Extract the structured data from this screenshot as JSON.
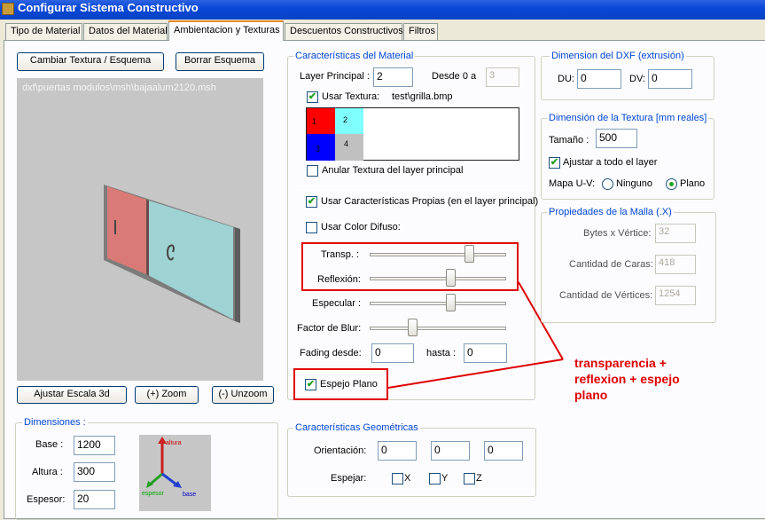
{
  "window": {
    "title": "Configurar Sistema Constructivo"
  },
  "tabs": [
    {
      "label": "Tipo de Material"
    },
    {
      "label": "Datos del Material"
    },
    {
      "label": "Ambientacion y Texturas"
    },
    {
      "label": "Descuentos Constructivos"
    },
    {
      "label": "Filtros"
    }
  ],
  "left": {
    "change_texture_label": "Cambiar Textura / Esquema",
    "erase_scheme_label": "Borrar Esquema",
    "preview_path": "dxf\\puertas modulos\\msh\\bajaalum2120.msh",
    "fit_scale_label": "Ajustar Escala 3d",
    "zoom_label": "(+) Zoom",
    "unzoom_label": "(-) Unzoom"
  },
  "dimensiones": {
    "title": "Dimensiones :",
    "base_label": "Base :",
    "base_value": "1200",
    "altura_label": "Altura :",
    "altura_value": "300",
    "espesor_label": "Espesor:",
    "espesor_value": "20",
    "axis_altura": "altura",
    "axis_espesor": "espesor",
    "axis_base": "base"
  },
  "material": {
    "title": "Características del Material",
    "layer_label": "Layer Principal :",
    "layer_value": "2",
    "desde_label": "Desde 0 a",
    "desde_value": "3",
    "usar_textura_label": "Usar Textura:",
    "usar_textura_checked": true,
    "texture_file": "test\\grilla.bmp",
    "cells": [
      "1",
      "2",
      "3",
      "4"
    ],
    "anular_label": "Anular Textura del layer principal",
    "anular_checked": false,
    "propias_label": "Usar Características Propias (en el layer principal)",
    "propias_checked": true,
    "difuso_label": "Usar Color Difuso:",
    "difuso_checked": false,
    "transp_label": "Transp. :",
    "transp_level": 0.75,
    "reflexion_label": "Reflexión:",
    "reflexion_level": 0.6,
    "especular_label": "Especular :",
    "especular_level": 0.6,
    "blur_label": "Factor de Blur:",
    "blur_level": 0.3,
    "fading_label": "Fading desde:",
    "fading_value": "0",
    "hasta_label": "hasta :",
    "hasta_value": "0",
    "espejo_label": "Espejo Plano",
    "espejo_checked": true
  },
  "dxf": {
    "title": "Dimension del DXF (extrusión)",
    "du_label": "DU:",
    "du_value": "0",
    "dv_label": "DV:",
    "dv_value": "0"
  },
  "textura_dim": {
    "title": "Dimensión de la Textura [mm reales]",
    "tamano_label": "Tamaño :",
    "tamano_value": "500",
    "ajustar_label": "Ajustar a todo el layer",
    "ajustar_checked": true,
    "mapa_label": "Mapa U-V:",
    "ninguno_label": "Ninguno",
    "plano_label": "Plano",
    "selected": "Plano"
  },
  "malla": {
    "title": "Propiedades de la Malla (.X)",
    "bytes_label": "Bytes x Vértice:",
    "bytes_value": "32",
    "caras_label": "Cantidad de Caras:",
    "caras_value": "418",
    "vertices_label": "Cantidad de Vértices:",
    "vertices_value": "1254"
  },
  "geometricas": {
    "title": "Características Geométricas",
    "orientacion_label": "Orientación:",
    "orient_values": [
      "0",
      "0",
      "0"
    ],
    "espejar_label": "Espejar:",
    "x_label": "X",
    "y_label": "Y",
    "z_label": "Z"
  },
  "annotation": {
    "line1": "transparencia +",
    "line2": "reflexion + espejo",
    "line3": "plano",
    "color": "#e00000"
  }
}
